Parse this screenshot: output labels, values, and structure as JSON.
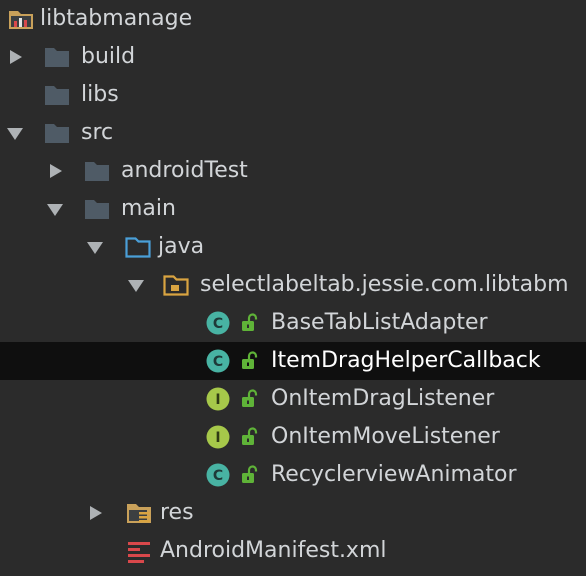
{
  "project_tree": {
    "root": {
      "label": "libtabmanage",
      "icon": "module-folder-icon"
    },
    "build": {
      "label": "build",
      "icon": "folder-icon",
      "state": "collapsed"
    },
    "libs": {
      "label": "libs",
      "icon": "folder-icon"
    },
    "src": {
      "label": "src",
      "icon": "folder-icon",
      "state": "expanded"
    },
    "androidTest": {
      "label": "androidTest",
      "icon": "folder-icon",
      "state": "collapsed"
    },
    "main": {
      "label": "main",
      "icon": "folder-icon",
      "state": "expanded"
    },
    "java": {
      "label": "java",
      "icon": "source-folder-icon",
      "state": "expanded"
    },
    "package": {
      "label": "selectlabeltab.jessie.com.libtabm",
      "icon": "package-icon",
      "state": "expanded"
    },
    "classes": [
      {
        "label": "BaseTabListAdapter",
        "kind": "C",
        "icon": "class-icon",
        "selected": false
      },
      {
        "label": "ItemDragHelperCallback",
        "kind": "C",
        "icon": "class-icon",
        "selected": true
      },
      {
        "label": "OnItemDragListener",
        "kind": "I",
        "icon": "interface-icon",
        "selected": false
      },
      {
        "label": "OnItemMoveListener",
        "kind": "I",
        "icon": "interface-icon",
        "selected": false
      },
      {
        "label": "RecyclerviewAnimator",
        "kind": "C",
        "icon": "class-icon",
        "selected": false
      }
    ],
    "res": {
      "label": "res",
      "icon": "resources-folder-icon",
      "state": "collapsed"
    },
    "manifest": {
      "label": "AndroidManifest.xml",
      "icon": "manifest-icon"
    }
  },
  "colors": {
    "background": "#2b2b2b",
    "selection": "#0f0f0f",
    "text": "#d2d5d8",
    "folder": "#4f5b66",
    "class_badge": "#48b3a3",
    "interface_badge": "#a6c84a",
    "lock": "#5fb338",
    "package_folder": "#d9a441",
    "manifest": "#d9484b"
  }
}
